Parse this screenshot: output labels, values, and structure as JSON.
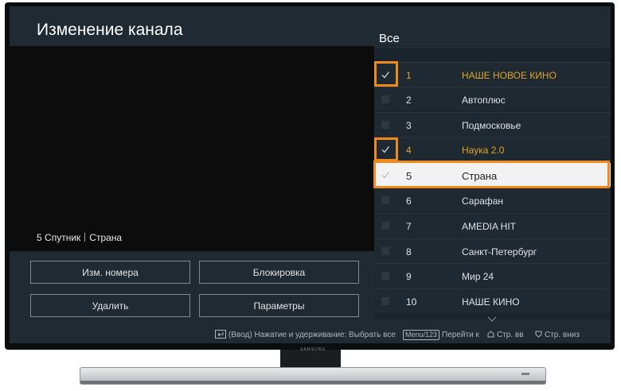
{
  "screen": {
    "title": "Изменение канала",
    "current_channel": {
      "number": "5",
      "source": "Спутник",
      "name": "Страна"
    }
  },
  "buttons": {
    "change_number": "Изм. номера",
    "lock": "Блокировка",
    "delete": "Удалить",
    "options": "Параметры"
  },
  "list": {
    "header": "Все",
    "channels": [
      {
        "number": "1",
        "name": "НАШЕ НОВОЕ КИНО",
        "checked": true,
        "highlighted": true
      },
      {
        "number": "2",
        "name": "Автоплюс",
        "checked": false
      },
      {
        "number": "3",
        "name": "Подмосковье",
        "checked": false
      },
      {
        "number": "4",
        "name": "Наука 2.0",
        "checked": true,
        "highlighted": true
      },
      {
        "number": "5",
        "name": "Страна",
        "checked": false,
        "focused": true
      },
      {
        "number": "6",
        "name": "Сарафан",
        "checked": false
      },
      {
        "number": "7",
        "name": "AMEDIA HIT",
        "checked": false
      },
      {
        "number": "8",
        "name": "Санкт-Петербург",
        "checked": false
      },
      {
        "number": "9",
        "name": "Мир 24",
        "checked": false
      },
      {
        "number": "10",
        "name": "НАШЕ КИНО",
        "checked": false
      }
    ]
  },
  "footer": {
    "enter_hint": "(Ввод) Нажатие и удерживание: Выбрать все",
    "menu_key": "Menu/123",
    "goto_label": "Перейти к",
    "page_up": "Стр. вв",
    "page_down": "Стр. вниз"
  },
  "tv": {
    "brand": "SAMSUNG"
  },
  "colors": {
    "accent": "#e0a52a",
    "highlight_box": "#f08a1c",
    "screen_bg": "#1f2a33"
  }
}
